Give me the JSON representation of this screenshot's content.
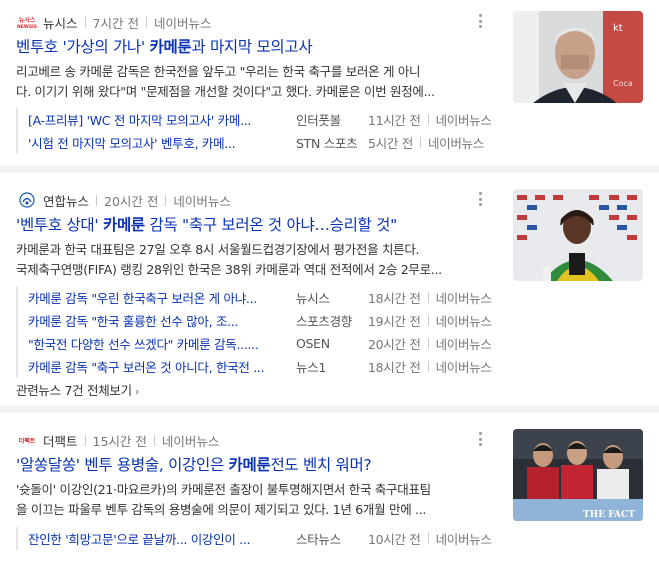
{
  "articles": [
    {
      "source": "뉴시스",
      "logo_text": "뉴시스 NEWSIS",
      "time": "7시간 전",
      "nav": "네이버뉴스",
      "title_pre": "벤투호 '가상의 가나' ",
      "title_bold": "카메룬",
      "title_post": "과 마지막 모의고사",
      "desc_line1": "리고베르 송 카메룬 감독은 한국전을 앞두고 \"우리는 한국 축구를 보러온 게 아니",
      "desc_line2": "다. 이기기 위해 왔다\"며 \"문제점을 개선할 것이다\"고 했다. 카메룬은 이번 원정에...",
      "related": [
        {
          "title": "[A-프리뷰] 'WC 전 마지막 모의고사' 카메...",
          "source": "인터풋볼",
          "time": "11시간 전",
          "nav": "네이버뉴스"
        },
        {
          "title": "'시험 전 마지막 모의고사' 벤투호, 카메...",
          "source": "STN 스포츠",
          "time": "5시간 전",
          "nav": "네이버뉴스"
        }
      ]
    },
    {
      "source": "연합뉴스",
      "time": "20시간 전",
      "nav": "네이버뉴스",
      "title_pre": "'벤투호 상대' ",
      "title_bold": "카메룬",
      "title_post": " 감독 \"축구 보러온 것 아냐…승리할 것\"",
      "desc_line1": "카메룬과 한국 대표팀은 27일 오후 8시 서울월드컵경기장에서 평가전을 치른다.",
      "desc_line2": "국제축구연맹(FIFA) 랭킹 28위인 한국은 38위 카메룬과 역대 전적에서 2승 2무로...",
      "related": [
        {
          "title": "카메룬 감독 \"우린 한국축구 보러온 게 아냐...",
          "source": "뉴시스",
          "time": "18시간 전",
          "nav": "네이버뉴스"
        },
        {
          "title": "카메룬 감독 \"한국 훌륭한 선수 많아, 조...",
          "source": "스포츠경향",
          "time": "19시간 전",
          "nav": "네이버뉴스"
        },
        {
          "title": "\"한국전 다양한 선수 쓰겠다\" 카메룬 감독......",
          "source": "OSEN",
          "time": "20시간 전",
          "nav": "네이버뉴스"
        },
        {
          "title": "카메룬 감독 \"축구 보러온 것 아니다, 한국전 ...",
          "source": "뉴스1",
          "time": "18시간 전",
          "nav": "네이버뉴스"
        }
      ],
      "all_news": "관련뉴스 7건 전체보기"
    },
    {
      "source": "더팩트",
      "logo_text": "더팩트",
      "time": "15시간 전",
      "nav": "네이버뉴스",
      "title_pre": "'알쏭달쏭' 벤투 용병술, 이강인은 ",
      "title_bold": "카메룬",
      "title_post": "전도 벤치 워머?",
      "desc_line1": "'슛돌이' 이강인(21·마요르카)의 카메룬전 출장이 불투명해지면서 한국 축구대표팀",
      "desc_line2": "을 이끄는 파울루 벤투 감독의 용병술에 의문이 제기되고 있다. 1년 6개월 만에 ...",
      "thumb_watermark": "THE FACT",
      "related": [
        {
          "title": "잔인한 '희망고문'으로 끝날까... 이강인이 ...",
          "source": "스타뉴스",
          "time": "10시간 전",
          "nav": "네이버뉴스"
        }
      ]
    }
  ],
  "colors": {
    "title_link": "#0a33b2",
    "separator": "#f2f3f6"
  }
}
